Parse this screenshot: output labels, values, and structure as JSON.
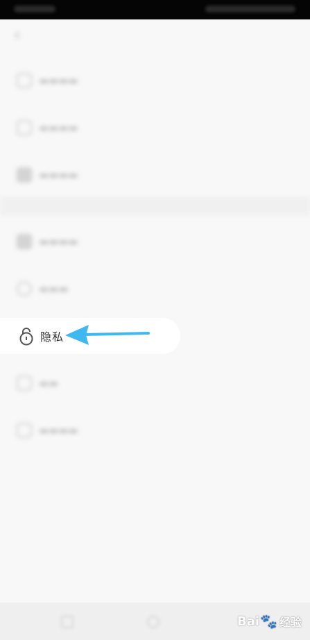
{
  "privacy_item": {
    "label": "隐私",
    "icon": "lock-icon"
  },
  "annotation": {
    "arrow_color": "#3fb8f2",
    "points_to": "privacy-item"
  },
  "watermark": {
    "brand": "Bai",
    "suffix": "经验",
    "paw": "🐾"
  },
  "colors": {
    "background": "#f8f8f8",
    "status_bar": "#050505",
    "arrow": "#3fb8f2"
  }
}
